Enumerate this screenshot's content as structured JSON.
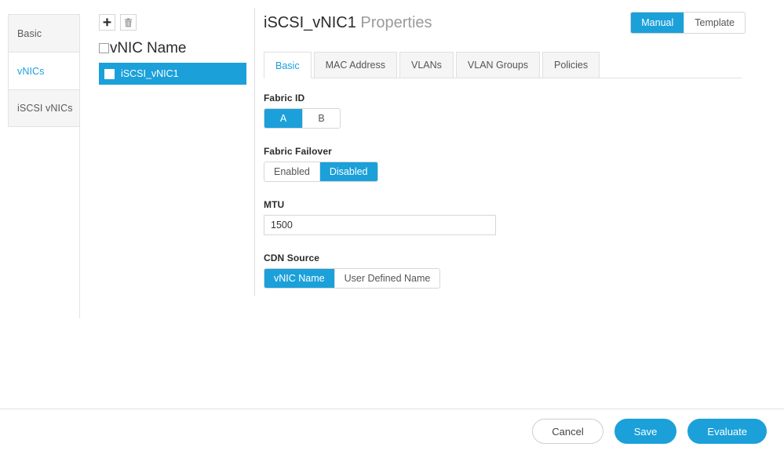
{
  "sidebar": {
    "items": [
      {
        "label": "Basic",
        "active": false
      },
      {
        "label": "vNICs",
        "active": true
      },
      {
        "label": "iSCSI vNICs",
        "active": false
      }
    ]
  },
  "list_panel": {
    "toolbar": {
      "add_icon": "plus-icon",
      "delete_icon": "trash-icon"
    },
    "header": {
      "select_all_checked": false,
      "column_label": "vNIC Name"
    },
    "rows": [
      {
        "name": "iSCSI_vNIC1",
        "selected": true,
        "checked": false
      }
    ]
  },
  "detail": {
    "title_name": "iSCSI_vNIC1",
    "title_suffix": "Properties",
    "mode_toggle": {
      "options": [
        "Manual",
        "Template"
      ],
      "selected": "Manual"
    },
    "tabs": [
      {
        "label": "Basic",
        "active": true
      },
      {
        "label": "MAC Address",
        "active": false
      },
      {
        "label": "VLANs",
        "active": false
      },
      {
        "label": "VLAN Groups",
        "active": false
      },
      {
        "label": "Policies",
        "active": false
      }
    ],
    "fields": {
      "fabric_id": {
        "label": "Fabric ID",
        "options": [
          "A",
          "B"
        ],
        "selected": "A"
      },
      "fabric_failover": {
        "label": "Fabric Failover",
        "options": [
          "Enabled",
          "Disabled"
        ],
        "selected": "Disabled"
      },
      "mtu": {
        "label": "MTU",
        "value": "1500",
        "placeholder": "1500"
      },
      "cdn_source": {
        "label": "CDN Source",
        "options": [
          "vNIC Name",
          "User Defined Name"
        ],
        "selected": "vNIC Name"
      }
    }
  },
  "footer": {
    "cancel_label": "Cancel",
    "save_label": "Save",
    "evaluate_label": "Evaluate"
  },
  "colors": {
    "accent": "#1ba0da",
    "border": "#e0e0e0",
    "panel_gray": "#f5f5f5",
    "text": "#333333",
    "muted_text": "#9b9b9b"
  }
}
